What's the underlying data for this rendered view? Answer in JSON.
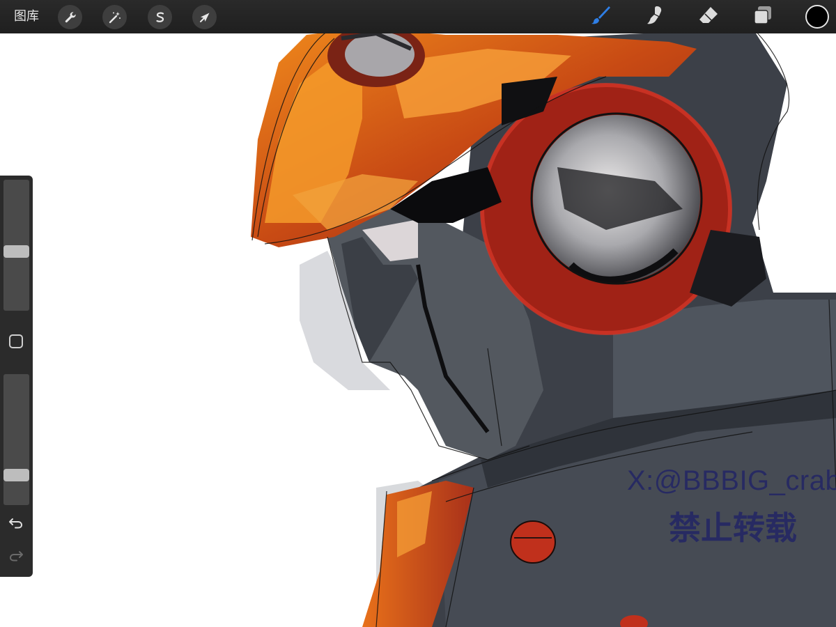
{
  "toolbar": {
    "gallery_label": "图库",
    "actions": [
      {
        "name": "actions-button",
        "icon": "wrench-icon"
      },
      {
        "name": "adjustments-button",
        "icon": "magic-wand-icon"
      },
      {
        "name": "selection-button",
        "icon": "selection-s-icon"
      },
      {
        "name": "transform-button",
        "icon": "cursor-arrow-icon"
      }
    ],
    "tools": [
      {
        "name": "brush-tool",
        "icon": "brush-icon",
        "active": true,
        "color": "#2f7fe6"
      },
      {
        "name": "smudge-tool",
        "icon": "smudge-icon",
        "active": false,
        "color": "#dcdcdc"
      },
      {
        "name": "eraser-tool",
        "icon": "eraser-icon",
        "active": false,
        "color": "#dcdcdc"
      },
      {
        "name": "layers-tool",
        "icon": "layers-icon",
        "active": false,
        "color": "#dcdcdc"
      }
    ],
    "current_color": "#000000"
  },
  "sidebar": {
    "brush_size_level": 0.45,
    "opacity_level": 0.2,
    "modify_icon": "square-icon",
    "undo_icon": "undo-icon",
    "redo_icon": "redo-icon",
    "redo_enabled": false
  },
  "canvas": {
    "watermark_handle": "X:@BBBIG_crab",
    "watermark_notice": "禁止转载",
    "watermark_color": "#1f2266"
  }
}
